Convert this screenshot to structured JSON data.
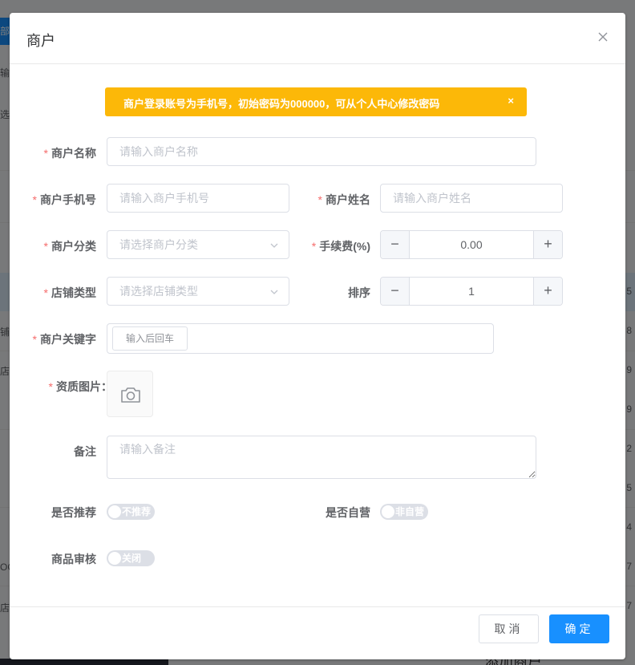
{
  "background": {
    "left_button": "部",
    "left_fragments": [
      "输",
      "选",
      "铺",
      "店",
      "OC",
      "店"
    ],
    "right_numbers": [
      "5",
      "8",
      "9",
      "9",
      "2",
      "5",
      "4",
      "7",
      "7"
    ],
    "bottom_text": "添加商户"
  },
  "dialog": {
    "title": "商户",
    "alert": "商户登录账号为手机号，初始密码为000000，可从个人中心修改密码",
    "alert_close": "×"
  },
  "form": {
    "merchant_name": {
      "label": "商户名称",
      "placeholder": "请输入商户名称",
      "value": ""
    },
    "merchant_phone": {
      "label": "商户手机号",
      "placeholder": "请输入商户手机号",
      "value": ""
    },
    "merchant_realname": {
      "label": "商户姓名",
      "placeholder": "请输入商户姓名",
      "value": ""
    },
    "merchant_category": {
      "label": "商户分类",
      "placeholder": "请选择商户分类"
    },
    "fee": {
      "label": "手续费(%)",
      "value": "0.00",
      "minus": "−",
      "plus": "+"
    },
    "store_type": {
      "label": "店铺类型",
      "placeholder": "请选择店铺类型"
    },
    "sort": {
      "label": "排序",
      "value": "1",
      "minus": "−",
      "plus": "+"
    },
    "keywords": {
      "label": "商户关键字",
      "tag_input": "输入后回车"
    },
    "qualification": {
      "label": "资质图片："
    },
    "remark": {
      "label": "备注",
      "placeholder": "请输入备注",
      "value": ""
    },
    "recommend": {
      "label": "是否推荐",
      "switch_text": "不推荐"
    },
    "self_operated": {
      "label": "是否自营",
      "switch_text": "非自营"
    },
    "product_review": {
      "label": "商品审核",
      "switch_text": "关闭"
    }
  },
  "footer": {
    "cancel": "取消",
    "confirm": "确定"
  },
  "colors": {
    "primary": "#1890ff",
    "alert": "#fcb808",
    "required": "#f56c6c"
  }
}
